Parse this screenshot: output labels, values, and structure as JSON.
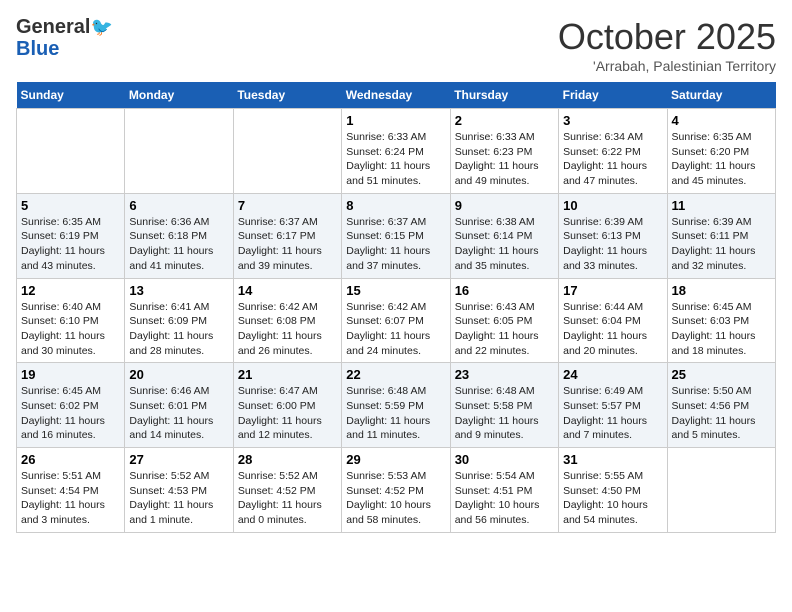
{
  "header": {
    "logo_general": "General",
    "logo_blue": "Blue",
    "month": "October 2025",
    "location": "'Arrabah, Palestinian Territory"
  },
  "days_of_week": [
    "Sunday",
    "Monday",
    "Tuesday",
    "Wednesday",
    "Thursday",
    "Friday",
    "Saturday"
  ],
  "weeks": [
    [
      {
        "day": null
      },
      {
        "day": null
      },
      {
        "day": null
      },
      {
        "day": 1,
        "sunrise": "Sunrise: 6:33 AM",
        "sunset": "Sunset: 6:24 PM",
        "daylight": "Daylight: 11 hours and 51 minutes."
      },
      {
        "day": 2,
        "sunrise": "Sunrise: 6:33 AM",
        "sunset": "Sunset: 6:23 PM",
        "daylight": "Daylight: 11 hours and 49 minutes."
      },
      {
        "day": 3,
        "sunrise": "Sunrise: 6:34 AM",
        "sunset": "Sunset: 6:22 PM",
        "daylight": "Daylight: 11 hours and 47 minutes."
      },
      {
        "day": 4,
        "sunrise": "Sunrise: 6:35 AM",
        "sunset": "Sunset: 6:20 PM",
        "daylight": "Daylight: 11 hours and 45 minutes."
      }
    ],
    [
      {
        "day": 5,
        "sunrise": "Sunrise: 6:35 AM",
        "sunset": "Sunset: 6:19 PM",
        "daylight": "Daylight: 11 hours and 43 minutes."
      },
      {
        "day": 6,
        "sunrise": "Sunrise: 6:36 AM",
        "sunset": "Sunset: 6:18 PM",
        "daylight": "Daylight: 11 hours and 41 minutes."
      },
      {
        "day": 7,
        "sunrise": "Sunrise: 6:37 AM",
        "sunset": "Sunset: 6:17 PM",
        "daylight": "Daylight: 11 hours and 39 minutes."
      },
      {
        "day": 8,
        "sunrise": "Sunrise: 6:37 AM",
        "sunset": "Sunset: 6:15 PM",
        "daylight": "Daylight: 11 hours and 37 minutes."
      },
      {
        "day": 9,
        "sunrise": "Sunrise: 6:38 AM",
        "sunset": "Sunset: 6:14 PM",
        "daylight": "Daylight: 11 hours and 35 minutes."
      },
      {
        "day": 10,
        "sunrise": "Sunrise: 6:39 AM",
        "sunset": "Sunset: 6:13 PM",
        "daylight": "Daylight: 11 hours and 33 minutes."
      },
      {
        "day": 11,
        "sunrise": "Sunrise: 6:39 AM",
        "sunset": "Sunset: 6:11 PM",
        "daylight": "Daylight: 11 hours and 32 minutes."
      }
    ],
    [
      {
        "day": 12,
        "sunrise": "Sunrise: 6:40 AM",
        "sunset": "Sunset: 6:10 PM",
        "daylight": "Daylight: 11 hours and 30 minutes."
      },
      {
        "day": 13,
        "sunrise": "Sunrise: 6:41 AM",
        "sunset": "Sunset: 6:09 PM",
        "daylight": "Daylight: 11 hours and 28 minutes."
      },
      {
        "day": 14,
        "sunrise": "Sunrise: 6:42 AM",
        "sunset": "Sunset: 6:08 PM",
        "daylight": "Daylight: 11 hours and 26 minutes."
      },
      {
        "day": 15,
        "sunrise": "Sunrise: 6:42 AM",
        "sunset": "Sunset: 6:07 PM",
        "daylight": "Daylight: 11 hours and 24 minutes."
      },
      {
        "day": 16,
        "sunrise": "Sunrise: 6:43 AM",
        "sunset": "Sunset: 6:05 PM",
        "daylight": "Daylight: 11 hours and 22 minutes."
      },
      {
        "day": 17,
        "sunrise": "Sunrise: 6:44 AM",
        "sunset": "Sunset: 6:04 PM",
        "daylight": "Daylight: 11 hours and 20 minutes."
      },
      {
        "day": 18,
        "sunrise": "Sunrise: 6:45 AM",
        "sunset": "Sunset: 6:03 PM",
        "daylight": "Daylight: 11 hours and 18 minutes."
      }
    ],
    [
      {
        "day": 19,
        "sunrise": "Sunrise: 6:45 AM",
        "sunset": "Sunset: 6:02 PM",
        "daylight": "Daylight: 11 hours and 16 minutes."
      },
      {
        "day": 20,
        "sunrise": "Sunrise: 6:46 AM",
        "sunset": "Sunset: 6:01 PM",
        "daylight": "Daylight: 11 hours and 14 minutes."
      },
      {
        "day": 21,
        "sunrise": "Sunrise: 6:47 AM",
        "sunset": "Sunset: 6:00 PM",
        "daylight": "Daylight: 11 hours and 12 minutes."
      },
      {
        "day": 22,
        "sunrise": "Sunrise: 6:48 AM",
        "sunset": "Sunset: 5:59 PM",
        "daylight": "Daylight: 11 hours and 11 minutes."
      },
      {
        "day": 23,
        "sunrise": "Sunrise: 6:48 AM",
        "sunset": "Sunset: 5:58 PM",
        "daylight": "Daylight: 11 hours and 9 minutes."
      },
      {
        "day": 24,
        "sunrise": "Sunrise: 6:49 AM",
        "sunset": "Sunset: 5:57 PM",
        "daylight": "Daylight: 11 hours and 7 minutes."
      },
      {
        "day": 25,
        "sunrise": "Sunrise: 5:50 AM",
        "sunset": "Sunset: 4:56 PM",
        "daylight": "Daylight: 11 hours and 5 minutes."
      }
    ],
    [
      {
        "day": 26,
        "sunrise": "Sunrise: 5:51 AM",
        "sunset": "Sunset: 4:54 PM",
        "daylight": "Daylight: 11 hours and 3 minutes."
      },
      {
        "day": 27,
        "sunrise": "Sunrise: 5:52 AM",
        "sunset": "Sunset: 4:53 PM",
        "daylight": "Daylight: 11 hours and 1 minute."
      },
      {
        "day": 28,
        "sunrise": "Sunrise: 5:52 AM",
        "sunset": "Sunset: 4:52 PM",
        "daylight": "Daylight: 11 hours and 0 minutes."
      },
      {
        "day": 29,
        "sunrise": "Sunrise: 5:53 AM",
        "sunset": "Sunset: 4:52 PM",
        "daylight": "Daylight: 10 hours and 58 minutes."
      },
      {
        "day": 30,
        "sunrise": "Sunrise: 5:54 AM",
        "sunset": "Sunset: 4:51 PM",
        "daylight": "Daylight: 10 hours and 56 minutes."
      },
      {
        "day": 31,
        "sunrise": "Sunrise: 5:55 AM",
        "sunset": "Sunset: 4:50 PM",
        "daylight": "Daylight: 10 hours and 54 minutes."
      },
      {
        "day": null
      }
    ]
  ]
}
